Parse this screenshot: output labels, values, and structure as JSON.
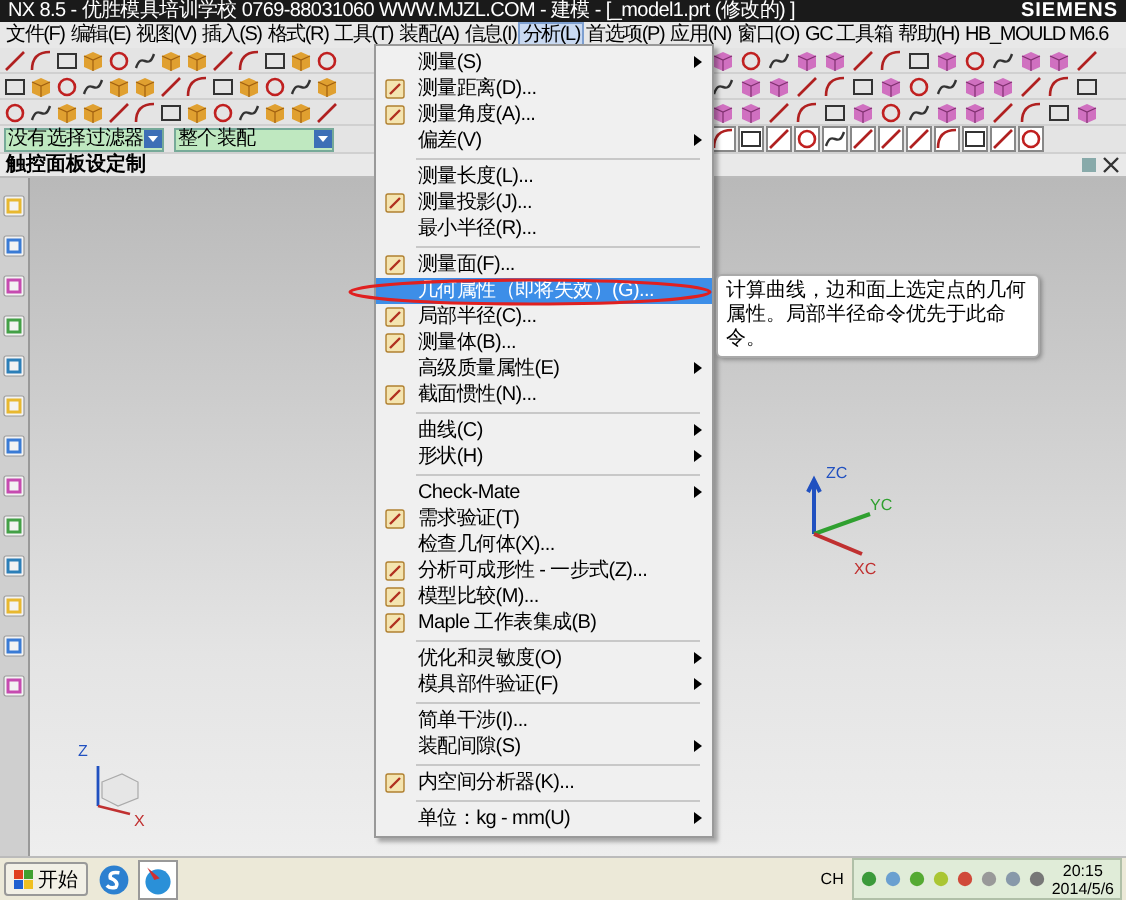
{
  "window": {
    "title": "NX 8.5 - 优胜模具培训学校 0769-88031060 WWW.MJZL.COM - 建模 - [_model1.prt (修改的) ]",
    "brand": "SIEMENS"
  },
  "menubar": [
    {
      "label": "文件(F)",
      "selected": false
    },
    {
      "label": "编辑(E)",
      "selected": false
    },
    {
      "label": "视图(V)",
      "selected": false
    },
    {
      "label": "插入(S)",
      "selected": false
    },
    {
      "label": "格式(R)",
      "selected": false
    },
    {
      "label": "工具(T)",
      "selected": false
    },
    {
      "label": "装配(A)",
      "selected": false
    },
    {
      "label": "信息(I)",
      "selected": false
    },
    {
      "label": "分析(L)",
      "selected": true
    },
    {
      "label": "首选项(P)",
      "selected": false
    },
    {
      "label": "应用(N)",
      "selected": false
    },
    {
      "label": "窗口(O)",
      "selected": false
    },
    {
      "label": "GC 工具箱",
      "selected": false
    },
    {
      "label": "帮助(H)",
      "selected": false
    },
    {
      "label": "HB_MOULD M6.6",
      "selected": false
    }
  ],
  "selection_bar": {
    "filter": "没有选择过滤器",
    "scope": "整个装配"
  },
  "resource_bar": {
    "title": "触控面板设定制"
  },
  "analysis_menu": {
    "items": [
      {
        "kind": "submenu",
        "label": "测量(S)",
        "has_icon": false,
        "selected": false
      },
      {
        "kind": "item",
        "label": "测量距离(D)...",
        "has_icon": true,
        "selected": false
      },
      {
        "kind": "item",
        "label": "测量角度(A)...",
        "has_icon": true,
        "selected": false
      },
      {
        "kind": "submenu",
        "label": "偏差(V)",
        "has_icon": false,
        "selected": false
      },
      {
        "kind": "separator"
      },
      {
        "kind": "item",
        "label": "测量长度(L)...",
        "has_icon": false,
        "selected": false
      },
      {
        "kind": "item",
        "label": "测量投影(J)...",
        "has_icon": true,
        "selected": false
      },
      {
        "kind": "item",
        "label": "最小半径(R)...",
        "has_icon": false,
        "selected": false
      },
      {
        "kind": "separator"
      },
      {
        "kind": "item",
        "label": "测量面(F)...",
        "has_icon": true,
        "selected": false
      },
      {
        "kind": "item",
        "label": "几何属性（即将失效）(G)...",
        "has_icon": false,
        "selected": true
      },
      {
        "kind": "item",
        "label": "局部半径(C)...",
        "has_icon": true,
        "selected": false
      },
      {
        "kind": "item",
        "label": "测量体(B)...",
        "has_icon": true,
        "selected": false
      },
      {
        "kind": "submenu",
        "label": "高级质量属性(E)",
        "has_icon": false,
        "selected": false
      },
      {
        "kind": "item",
        "label": "截面惯性(N)...",
        "has_icon": true,
        "selected": false
      },
      {
        "kind": "separator"
      },
      {
        "kind": "submenu",
        "label": "曲线(C)",
        "has_icon": false,
        "selected": false
      },
      {
        "kind": "submenu",
        "label": "形状(H)",
        "has_icon": false,
        "selected": false
      },
      {
        "kind": "separator"
      },
      {
        "kind": "submenu",
        "label": "Check-Mate",
        "has_icon": false,
        "selected": false
      },
      {
        "kind": "item",
        "label": "需求验证(T)",
        "has_icon": true,
        "selected": false
      },
      {
        "kind": "item",
        "label": "检查几何体(X)...",
        "has_icon": false,
        "selected": false
      },
      {
        "kind": "item",
        "label": "分析可成形性 - 一步式(Z)...",
        "has_icon": true,
        "selected": false
      },
      {
        "kind": "item",
        "label": "模型比较(M)...",
        "has_icon": true,
        "selected": false
      },
      {
        "kind": "item",
        "label": "Maple 工作表集成(B)",
        "has_icon": true,
        "selected": false
      },
      {
        "kind": "separator"
      },
      {
        "kind": "submenu",
        "label": "优化和灵敏度(O)",
        "has_icon": false,
        "selected": false
      },
      {
        "kind": "submenu",
        "label": "模具部件验证(F)",
        "has_icon": false,
        "selected": false
      },
      {
        "kind": "separator"
      },
      {
        "kind": "item",
        "label": "简单干涉(I)...",
        "has_icon": false,
        "selected": false
      },
      {
        "kind": "submenu",
        "label": "装配间隙(S)",
        "has_icon": false,
        "selected": false
      },
      {
        "kind": "separator"
      },
      {
        "kind": "item",
        "label": "内空间分析器(K)...",
        "has_icon": true,
        "selected": false
      },
      {
        "kind": "separator"
      },
      {
        "kind": "submenu",
        "label": "单位：kg - mm(U)",
        "has_icon": false,
        "selected": false
      }
    ]
  },
  "tooltip": {
    "text": "计算曲线，边和面上选定点的几何属性。局部半径命令优先于此命令。"
  },
  "view_triad": {
    "z": "ZC",
    "y": "YC",
    "x": "XC"
  },
  "absolute_triad": {
    "z": "Z",
    "x": "X"
  },
  "taskbar": {
    "start": "开始",
    "input_indicator": "CH",
    "time": "20:15",
    "date": "2014/5/6"
  }
}
